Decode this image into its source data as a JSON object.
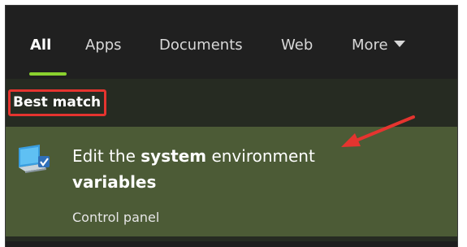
{
  "tabs": [
    {
      "label": "All",
      "active": true
    },
    {
      "label": "Apps",
      "active": false
    },
    {
      "label": "Documents",
      "active": false
    },
    {
      "label": "Web",
      "active": false
    },
    {
      "label": "More",
      "active": false
    }
  ],
  "section_label": "Best match",
  "best_match": {
    "title_prefix": "Edit the ",
    "title_bold": "system",
    "title_middle": " environment",
    "title_line2_bold": "variables",
    "subtitle": "Control panel",
    "icon": "system-properties-icon"
  },
  "colors": {
    "accent": "#8ad12e",
    "highlight_box": "#e5342f",
    "selected_item": "#4c5b36",
    "annotation_arrow": "#e5342f"
  }
}
